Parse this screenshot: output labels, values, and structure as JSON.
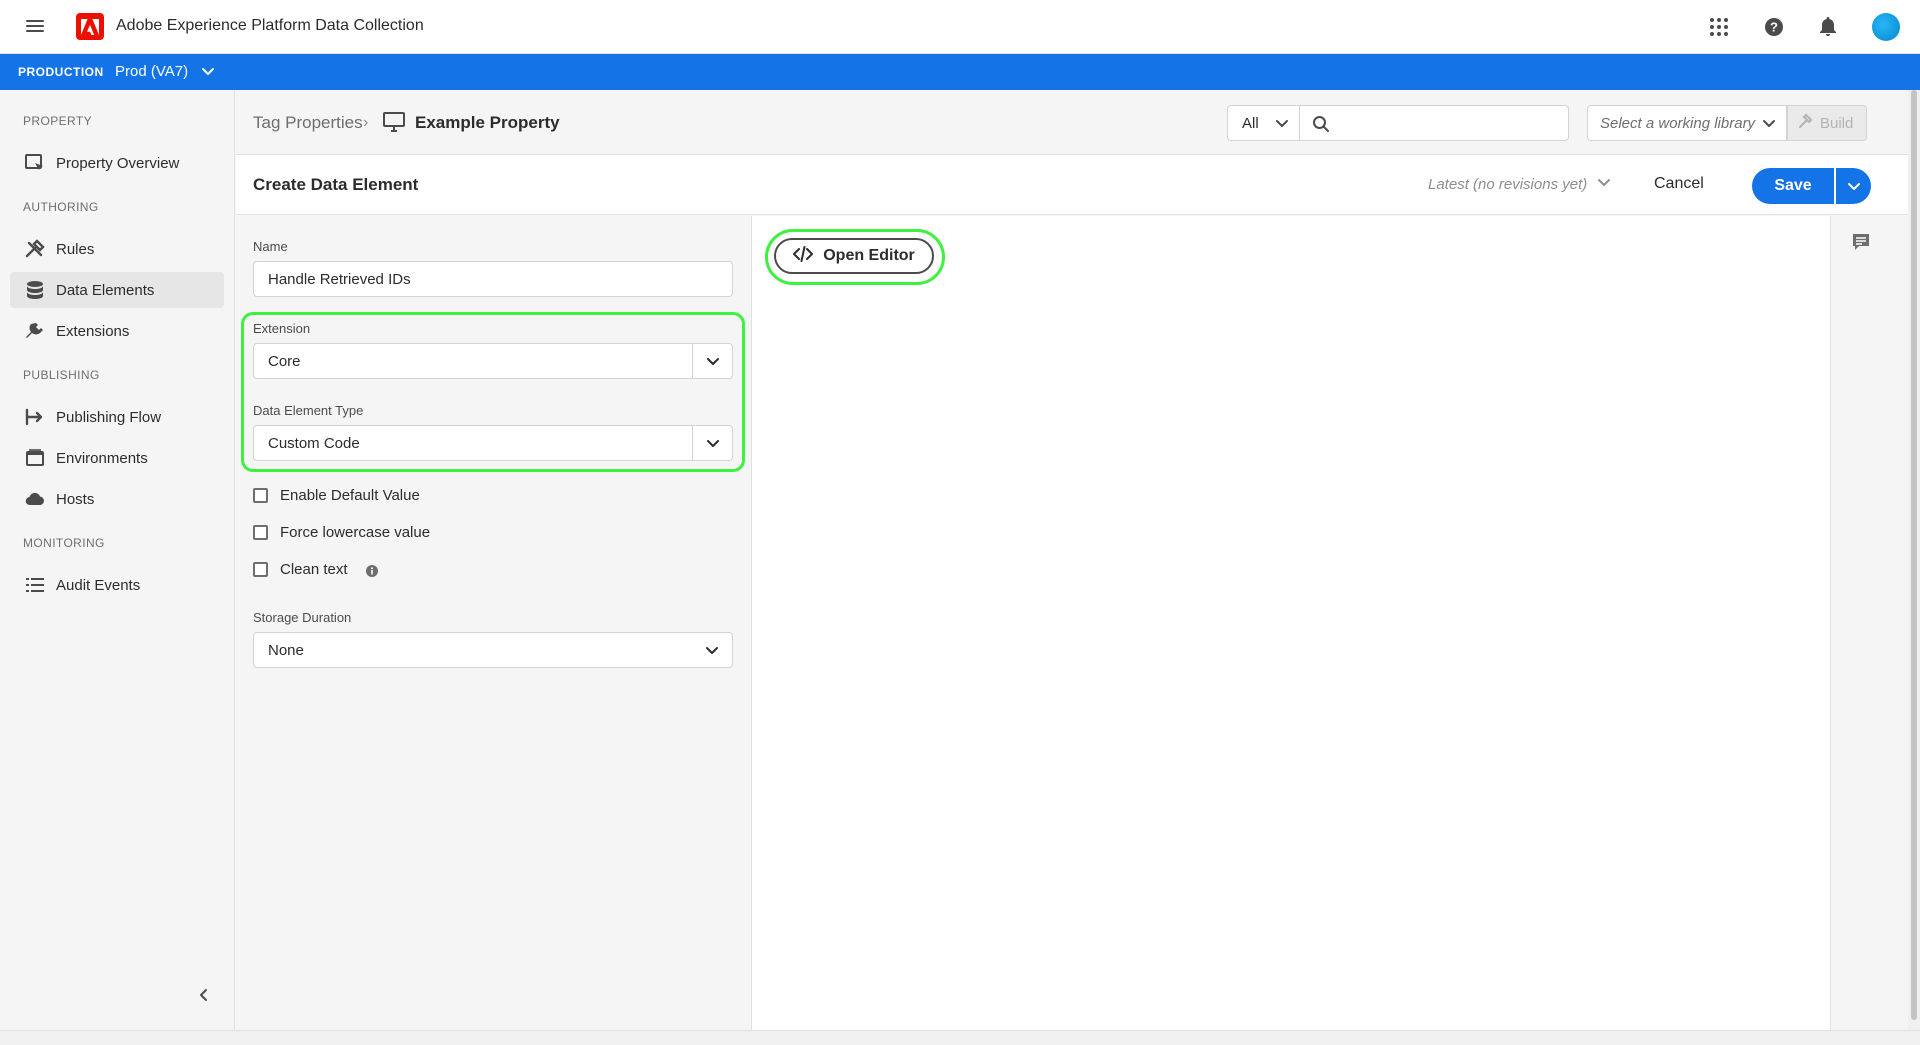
{
  "app": {
    "title": "Adobe Experience Platform Data Collection"
  },
  "environment": {
    "label": "PRODUCTION",
    "name": "Prod (VA7)"
  },
  "sidebar": {
    "sections": [
      {
        "title": "PROPERTY"
      },
      {
        "title": "AUTHORING"
      },
      {
        "title": "PUBLISHING"
      },
      {
        "title": "MONITORING"
      }
    ],
    "items": [
      {
        "label": "Property Overview",
        "icon": "property-overview-icon"
      },
      {
        "label": "Rules",
        "icon": "rules-icon"
      },
      {
        "label": "Data Elements",
        "icon": "data-elements-icon",
        "active": true
      },
      {
        "label": "Extensions",
        "icon": "extensions-icon"
      },
      {
        "label": "Publishing Flow",
        "icon": "publishing-flow-icon"
      },
      {
        "label": "Environments",
        "icon": "environments-icon"
      },
      {
        "label": "Hosts",
        "icon": "hosts-icon"
      },
      {
        "label": "Audit Events",
        "icon": "audit-events-icon"
      }
    ]
  },
  "breadcrumb": {
    "root": "Tag Properties",
    "separator": "›",
    "current": "Example Property"
  },
  "toolbar": {
    "filter_value": "All",
    "search_placeholder": "",
    "library_placeholder": "Select a working library",
    "build_label": "Build"
  },
  "header": {
    "title": "Create Data Element",
    "revision": "Latest (no revisions yet)",
    "cancel_label": "Cancel",
    "save_label": "Save"
  },
  "form": {
    "name_label": "Name",
    "name_value": "Handle Retrieved IDs",
    "extension_label": "Extension",
    "extension_value": "Core",
    "type_label": "Data Element Type",
    "type_value": "Custom Code",
    "checkboxes": [
      {
        "label": "Enable Default Value",
        "checked": false
      },
      {
        "label": "Force lowercase value",
        "checked": false
      },
      {
        "label": "Clean text",
        "checked": false
      }
    ],
    "storage_label": "Storage Duration",
    "storage_value": "None"
  },
  "editor": {
    "open_editor_label": "Open Editor"
  },
  "colors": {
    "accent": "#1473e6",
    "adobe_red": "#eb1000",
    "highlight": "#3df23d"
  }
}
